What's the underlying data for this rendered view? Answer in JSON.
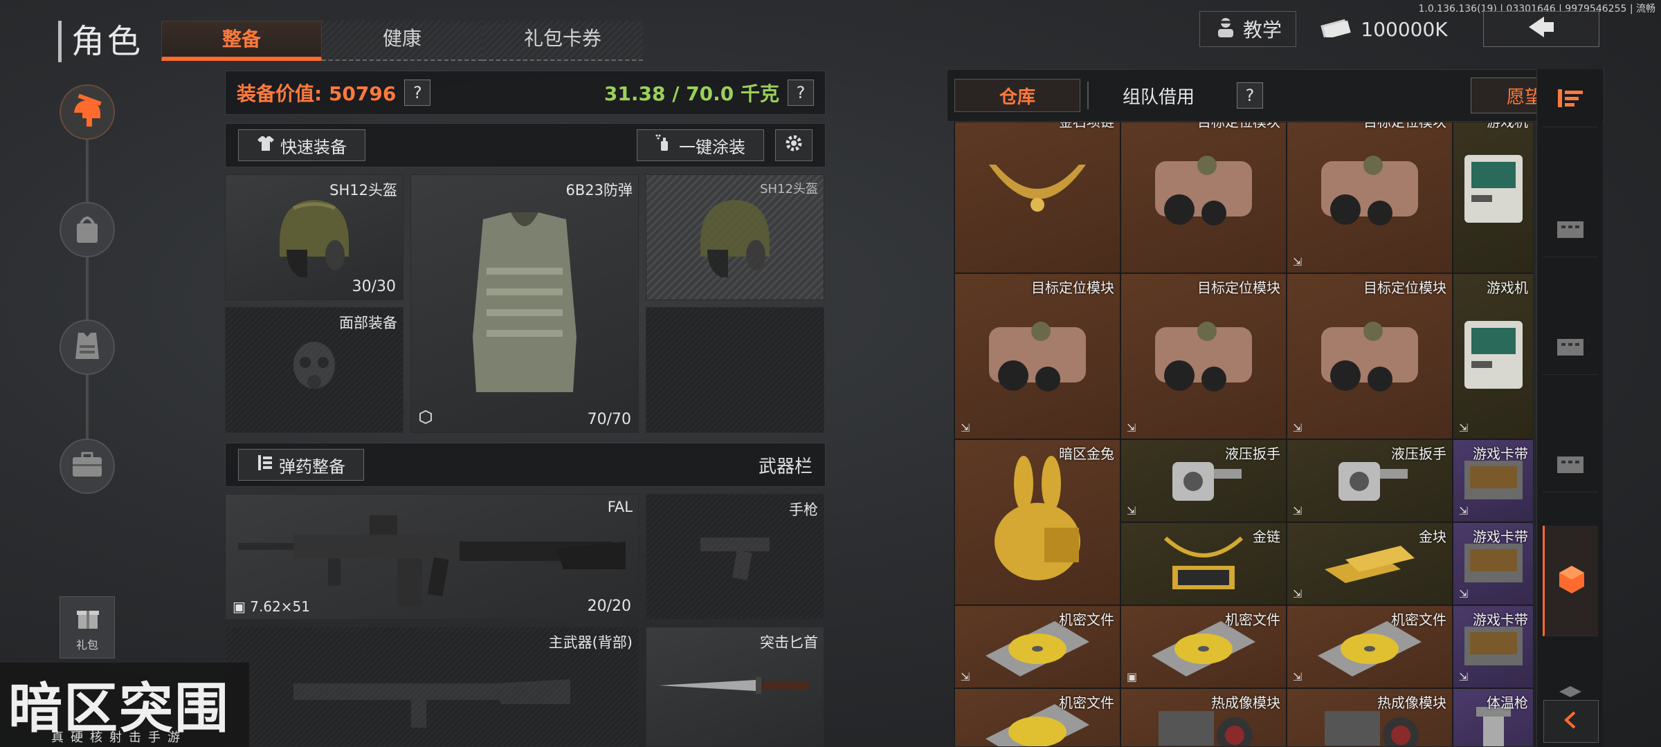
{
  "version": "1.0.136.136(19) | 03301646 | 9979546255 | 流畅",
  "page_title": "角色",
  "tabs": [
    {
      "label": "整备",
      "active": true
    },
    {
      "label": "健康",
      "active": false
    },
    {
      "label": "礼包卡券",
      "active": false
    }
  ],
  "topbar": {
    "teach_label": "教学",
    "money": "100000K"
  },
  "sidebar": {
    "gift_label": "礼包"
  },
  "equipment": {
    "value_label": "装备价值: 50796",
    "weight": "31.38 / 70.0 千克",
    "help": "?",
    "quick_equip": "快速装备",
    "one_click_paint": "一键涂装",
    "slots": {
      "helmet": {
        "name": "SH12头盔",
        "count": "30/30"
      },
      "armor": {
        "name": "6B23防弹",
        "count": "70/70"
      },
      "helmet_alt": {
        "name": "SH12头盔"
      },
      "face": {
        "name": "面部装备"
      }
    },
    "ammo_label": "弹药整备",
    "weapon_bar": "武器栏",
    "weapons": {
      "primary": {
        "name": "FAL",
        "ammo": "7.62×51",
        "count": "20/20"
      },
      "pistol": {
        "name": "手枪"
      },
      "back": {
        "name": "主武器(背部)"
      },
      "dagger": {
        "name": "突击匕首"
      }
    }
  },
  "warehouse": {
    "tab_storage": "仓库",
    "tab_team": "组队借用",
    "help": "?",
    "wishlist": "愿望单",
    "items_row0": [
      {
        "name": "金石项链",
        "bg": "brown"
      },
      {
        "name": "目标定位模块",
        "bg": "brown"
      },
      {
        "name": "目标定位模块",
        "bg": "brown"
      },
      {
        "name": "游戏机",
        "bg": "olive"
      }
    ],
    "items_row1": [
      {
        "name": "目标定位模块",
        "bg": "brown"
      },
      {
        "name": "目标定位模块",
        "bg": "brown"
      },
      {
        "name": "目标定位模块",
        "bg": "brown"
      },
      {
        "name": "游戏机",
        "bg": "olive"
      }
    ],
    "rabbit": {
      "name": "暗区金兔"
    },
    "wrench1": {
      "name": "液压扳手"
    },
    "wrench2": {
      "name": "液压扳手"
    },
    "cart1": {
      "name": "游戏卡带"
    },
    "chain": {
      "name": "金链"
    },
    "bars": {
      "name": "金块"
    },
    "cart2": {
      "name": "游戏卡带"
    },
    "docs_row": [
      {
        "name": "机密文件"
      },
      {
        "name": "机密文件"
      },
      {
        "name": "机密文件"
      },
      {
        "name": "游戏卡带"
      }
    ],
    "last_row": [
      {
        "name": "机密文件"
      },
      {
        "name": "热成像模块"
      },
      {
        "name": "热成像模块"
      },
      {
        "name": "体温枪"
      }
    ]
  },
  "logo": {
    "title": "暗区突围",
    "subtitle": "真硬核射击手游"
  },
  "colors": {
    "accent": "#ff6b2c",
    "weight_green": "#9bd05a"
  }
}
